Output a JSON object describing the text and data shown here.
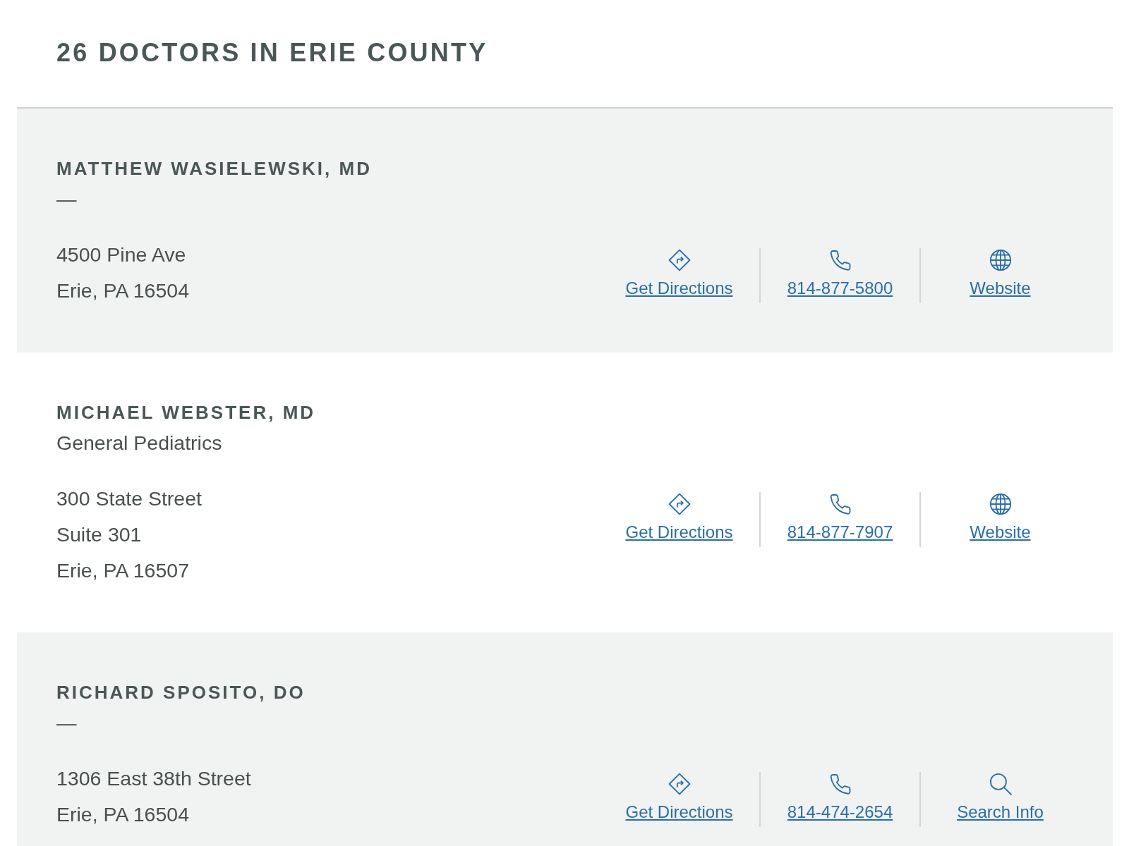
{
  "heading": "26 DOCTORS IN ERIE COUNTY",
  "doctors": [
    {
      "name": "MATTHEW WASIELEWSKI, MD",
      "specialty": "—",
      "address": [
        "4500 Pine Ave",
        "Erie, PA 16504"
      ],
      "actions": [
        {
          "kind": "directions",
          "label": "Get Directions"
        },
        {
          "kind": "phone",
          "label": "814-877-5800"
        },
        {
          "kind": "website",
          "label": "Website"
        }
      ]
    },
    {
      "name": "MICHAEL WEBSTER, MD",
      "specialty": "General Pediatrics",
      "address": [
        "300 State Street",
        "Suite 301",
        "Erie, PA 16507"
      ],
      "actions": [
        {
          "kind": "directions",
          "label": "Get Directions"
        },
        {
          "kind": "phone",
          "label": "814-877-7907"
        },
        {
          "kind": "website",
          "label": "Website"
        }
      ]
    },
    {
      "name": "RICHARD SPOSITO, DO",
      "specialty": "—",
      "address": [
        "1306 East 38th Street",
        "Erie, PA 16504"
      ],
      "actions": [
        {
          "kind": "directions",
          "label": "Get Directions"
        },
        {
          "kind": "phone",
          "label": "814-474-2654"
        },
        {
          "kind": "search",
          "label": "Search Info"
        }
      ]
    }
  ]
}
